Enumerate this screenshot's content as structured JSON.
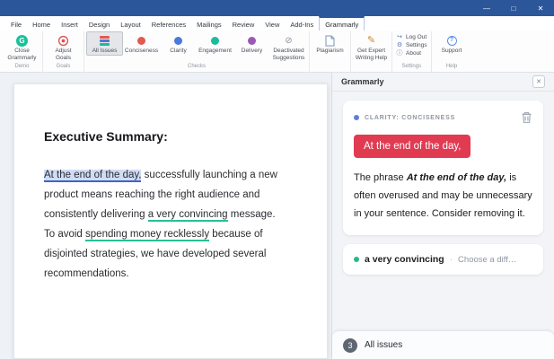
{
  "icons": {
    "grammarly_g": "G",
    "gear": "⚙",
    "info": "ⓘ",
    "logout": "↪",
    "pencil": "✎",
    "slash": "⊘",
    "question": "?",
    "minimize": "—",
    "maximize": "□",
    "close": "✕"
  },
  "tabs": {
    "items": [
      "File",
      "Home",
      "Insert",
      "Design",
      "Layout",
      "References",
      "Mailings",
      "Review",
      "View",
      "Add-Ins",
      "Grammarly"
    ],
    "active": "Grammarly"
  },
  "ribbon": {
    "close_grammarly": {
      "line1": "Close",
      "line2": "Grammarly"
    },
    "adjust_goals": {
      "line1": "Adjust",
      "line2": "Goals"
    },
    "all_issues": "All Issues",
    "conciseness": "Conciseness",
    "clarity": "Clarity",
    "engagement": "Engagement",
    "delivery": "Delivery",
    "deactivated": {
      "line1": "Deactivated",
      "line2": "Suggestions"
    },
    "plagiarism": "Plagiarism",
    "expert_help": {
      "line1": "Get Expert",
      "line2": "Writing Help"
    },
    "log_out": "Log Out",
    "settings": "Settings",
    "about": "About",
    "support": "Support",
    "groups": {
      "demo": "Demo",
      "goals": "Goals",
      "checks": "Checks",
      "settings": "Settings",
      "help": "Help"
    }
  },
  "document": {
    "heading": "Executive Summary:",
    "segments": [
      {
        "text": "At the end of the day,"
      },
      {
        "text": " successfully launching a new product means reaching the right audience and consistently delivering "
      },
      {
        "text": "a very convincing"
      },
      {
        "text": " message. To avoid "
      },
      {
        "text": "spending money recklessly"
      },
      {
        "text": " because of disjointed strategies, we have developed several recommendations."
      }
    ]
  },
  "panel": {
    "title": "Grammarly",
    "card": {
      "category": "CLARITY: CONCISENESS",
      "phrase": "At the end of the day,",
      "explain_before": "The phrase ",
      "explain_emphasis": "At the end of the day,",
      "explain_after": " is often overused and may be unnecessary in your sentence. Consider removing it."
    },
    "next_card": {
      "phrase": "a very convincing",
      "separator": "·",
      "hint": "Choose a diff…"
    },
    "footer": {
      "count": "3",
      "label": "All issues"
    }
  },
  "colors": {
    "word_blue": "#2b579a",
    "grammarly_green": "#15c39a",
    "alert_red": "#e13b52",
    "underline_teal": "#25c196",
    "highlight_blue": "#cfdcf5",
    "clarity_dot_blue": "#5f7fd8"
  }
}
